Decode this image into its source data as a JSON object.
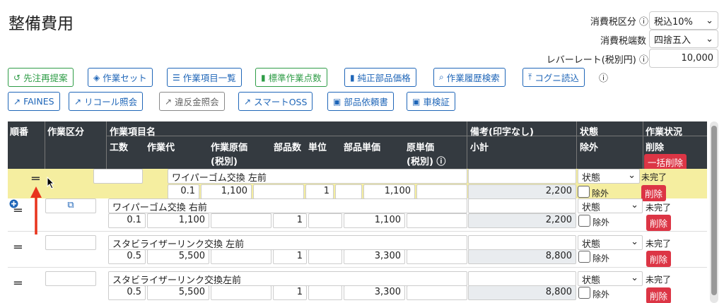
{
  "page": {
    "title": "整備費用"
  },
  "settings": {
    "tax_category_label": "消費税区分",
    "tax_category_value": "税込10%",
    "rounding_label": "消費税端数",
    "rounding_value": "四捨五入",
    "labor_rate_label": "レバーレート(税別円)",
    "labor_rate_value": "10,000"
  },
  "toolbar": {
    "row1": [
      "先注再提案",
      "作業セット",
      "作業項目一覧",
      "標準作業点数",
      "純正部品価格",
      "作業履歴検索",
      "コグニ読込"
    ],
    "row2": [
      "FAINES",
      "リコール照会",
      "違反金照会",
      "スマートOSS",
      "部品依頼書",
      "車検証"
    ]
  },
  "table": {
    "headers": {
      "order": "順番",
      "work_category": "作業区分",
      "work_item_name": "作業項目名",
      "man_hours": "工数",
      "labor_cost": "作業代",
      "work_cost": "作業原価",
      "tax_excl": "(税別)",
      "parts_qty": "部品数",
      "unit": "単位",
      "parts_unit_price": "部品単価",
      "original_unit_price": "原単価",
      "tax_excl2": "(税別)",
      "remarks": "備考(印字なし)",
      "subtotal": "小計",
      "status": "状態",
      "exclude": "除外",
      "work_status": "作業状況",
      "delete": "削除",
      "bulk_delete": "一括削除"
    },
    "rows": [
      {
        "name": "ワイパーゴム交換 左前",
        "man_hours": "0.1",
        "labor_cost": "1,100",
        "parts_qty": "1",
        "parts_unit_price": "1,100",
        "subtotal": "2,200",
        "status": "状態",
        "exclude": "除外",
        "work_status": "未完了",
        "delete": "削除"
      },
      {
        "name": "ワイパーゴム交換 右前",
        "man_hours": "0.1",
        "labor_cost": "1,100",
        "parts_qty": "1",
        "parts_unit_price": "1,100",
        "subtotal": "2,200",
        "status": "状態",
        "exclude": "除外",
        "work_status": "未完了",
        "delete": "削除"
      },
      {
        "name": "スタビライザーリンク交換 左前",
        "man_hours": "0.5",
        "labor_cost": "5,500",
        "parts_qty": "1",
        "parts_unit_price": "3,300",
        "subtotal": "8,800",
        "status": "状態",
        "exclude": "除外",
        "work_status": "未完了",
        "delete": "削除"
      },
      {
        "name": "スタビライザーリンク交換左前",
        "man_hours": "0.5",
        "labor_cost": "5,500",
        "parts_qty": "1",
        "parts_unit_price": "3,300",
        "subtotal": "8,800",
        "status": "状態",
        "exclude": "除外",
        "work_status": "未完了",
        "delete": "削除"
      }
    ]
  },
  "colors": {
    "accent_green": "#2e9c46",
    "accent_blue": "#1f66b8",
    "danger": "#dc3545",
    "header_bg": "#343a40",
    "drag_highlight": "#f5eea0",
    "arrow": "#e8331c"
  },
  "icons": [
    "help-circle-icon",
    "history-icon",
    "layers-icon",
    "list-icon",
    "book-icon",
    "search-icon",
    "upload-icon",
    "external-link-icon",
    "pdf-icon",
    "plus-circle-icon",
    "copy-icon",
    "drag-handle-icon",
    "cursor-icon",
    "red-arrow-icon",
    "select-chevron-icon"
  ]
}
